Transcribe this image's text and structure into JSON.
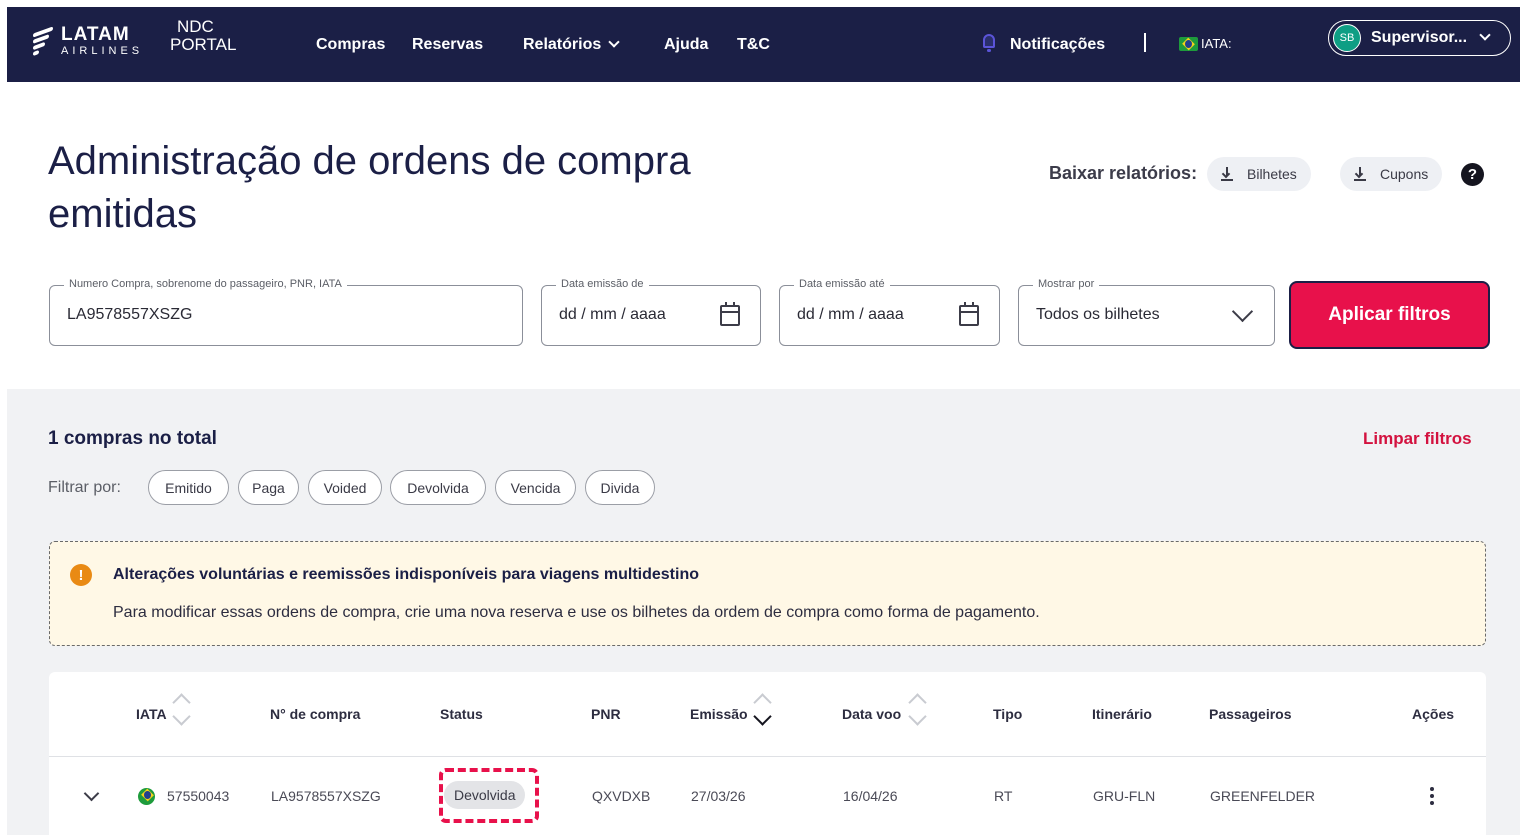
{
  "header": {
    "logo_latam": "LATAM",
    "logo_airlines": "AIRLINES",
    "portal_line1": "NDC",
    "portal_line2": "PORTAL",
    "nav": [
      {
        "label": "Compras"
      },
      {
        "label": "Reservas"
      },
      {
        "label": "Relatórios"
      },
      {
        "label": "Ajuda"
      },
      {
        "label": "T&C"
      }
    ],
    "notifications_label": "Notificações",
    "iata_label": "IATA:",
    "user_initials": "SB",
    "user_name": "Supervisor..."
  },
  "page": {
    "title": "Administração de ordens de compra emitidas",
    "reports_label": "Baixar relatórios:",
    "report_buttons": [
      {
        "label": "Bilhetes"
      },
      {
        "label": "Cupons"
      }
    ],
    "help_glyph": "?"
  },
  "filters": {
    "search": {
      "legend": "Numero Compra, sobrenome do passageiro, PNR, IATA",
      "value": "LA9578557XSZG"
    },
    "date_from": {
      "legend": "Data emissão de",
      "placeholder": "dd / mm / aaaa"
    },
    "date_to": {
      "legend": "Data emissão até",
      "placeholder": "dd / mm / aaaa"
    },
    "show_by": {
      "legend": "Mostrar por",
      "value": "Todos os bilhetes"
    },
    "apply_label": "Aplicar filtros"
  },
  "results": {
    "count_text": "1 compras no total",
    "clear_label": "Limpar filtros",
    "filter_by_label": "Filtrar por:",
    "chips": [
      "Emitido",
      "Paga",
      "Voided",
      "Devolvida",
      "Vencida",
      "Divida"
    ]
  },
  "alert": {
    "icon_glyph": "!",
    "title": "Alterações voluntárias e reemissões indisponíveis para viagens multidestino",
    "body": "Para modificar essas ordens de compra, crie uma nova reserva e use os bilhetes da ordem de compra como forma de pagamento."
  },
  "table": {
    "columns": [
      "IATA",
      "N° de compra",
      "Status",
      "PNR",
      "Emissão",
      "Data voo",
      "Tipo",
      "Itinerário",
      "Passageiros",
      "Ações"
    ],
    "rows": [
      {
        "iata": "57550043",
        "purchase_number": "LA9578557XSZG",
        "status": "Devolvida",
        "pnr": "QXVDXB",
        "emission": "27/03/26",
        "flight_date": "16/04/26",
        "type": "RT",
        "itinerary": "GRU-FLN",
        "passengers": "GREENFELDER"
      }
    ]
  },
  "colors": {
    "navbar": "#1b1f46",
    "accent": "#e8114b",
    "alert_bg": "#fff8e6",
    "warning_icon": "#e98a14"
  }
}
